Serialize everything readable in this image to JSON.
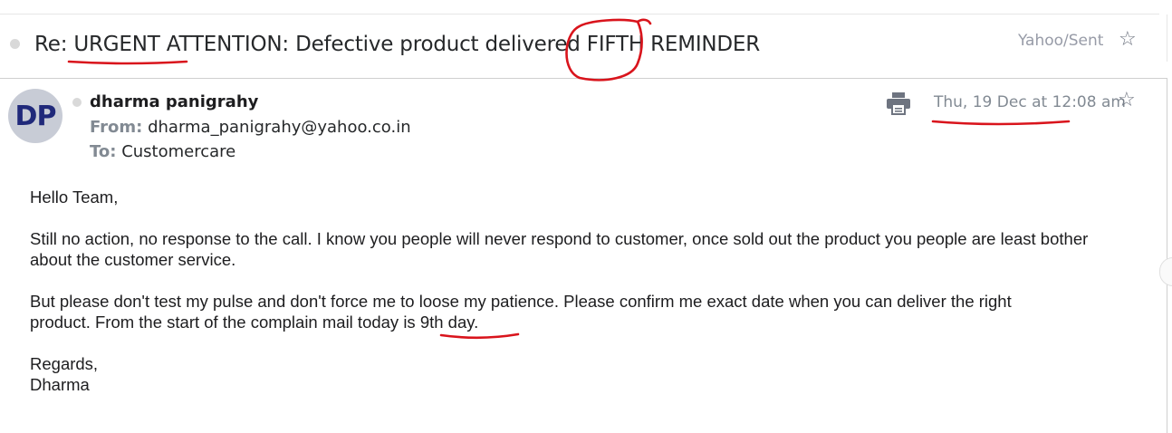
{
  "email": {
    "subject": "Re: URGENT ATTENTION: Defective product delivered FIFTH REMINDER",
    "folder": "Yahoo/Sent",
    "sender": {
      "initials": "DP",
      "name": "dharma panigrahy",
      "from_label": "From:",
      "from_address": "dharma_panigrahy@yahoo.co.in",
      "to_label": "To:",
      "to_address": "Customercare"
    },
    "date": "Thu, 19 Dec at 12:08 am",
    "body": {
      "greeting": "Hello Team,",
      "paragraph1": "Still no action, no response to the call. I know you people will never respond to customer, once sold out the product you people are least bother about the customer service.",
      "paragraph2_line1": "But please don't test my pulse and don't force me to loose my patience. Please confirm me exact date when you can deliver the right",
      "paragraph2_line2_prefix": "product. From the start of the complain mail today is ",
      "paragraph2_line2_highlight": "9th day.",
      "closing": "Regards,",
      "signature": "Dharma"
    }
  },
  "icons": {
    "star": "star-icon",
    "print": "print-icon",
    "unread_dot": "unread-dot-icon"
  },
  "colors": {
    "annotation_red": "#d9141c",
    "avatar_bg": "#c8ccd6",
    "avatar_text": "#20297a",
    "muted_text": "#828a93"
  }
}
